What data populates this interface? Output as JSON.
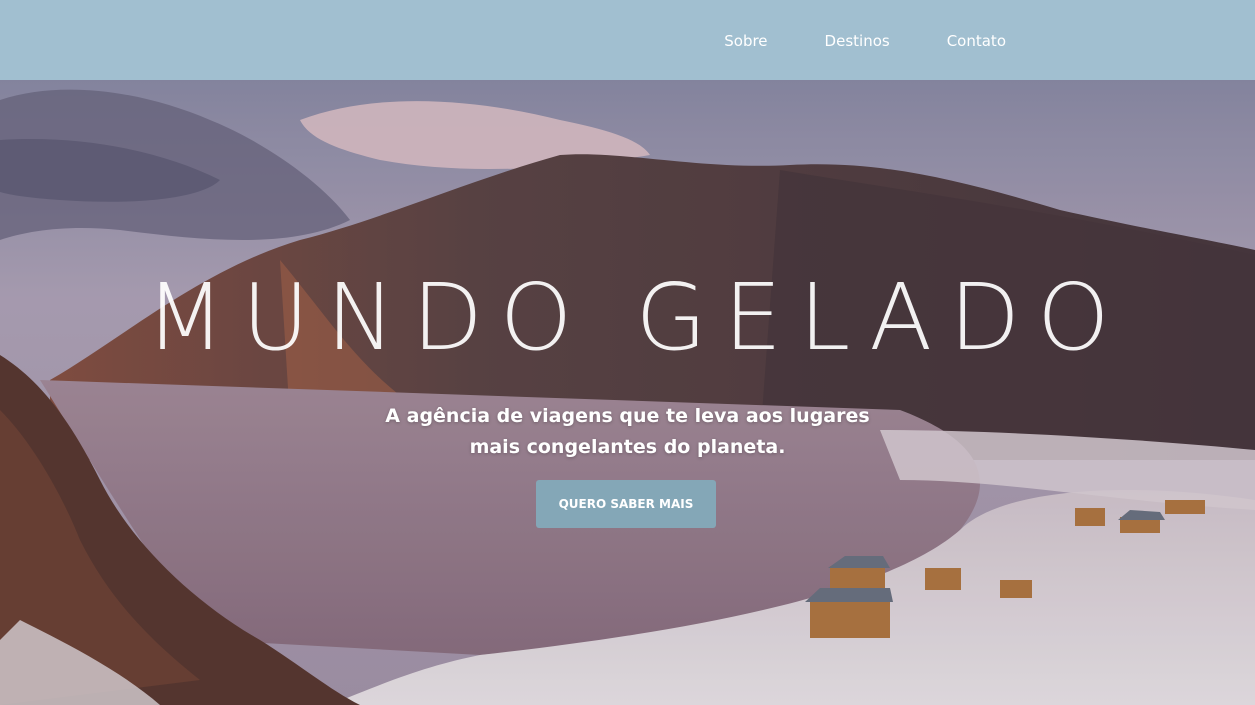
{
  "nav": {
    "items": [
      {
        "label": "Sobre"
      },
      {
        "label": "Destinos"
      },
      {
        "label": "Contato"
      }
    ]
  },
  "hero": {
    "title": "MUNDO GELADO",
    "subtitle": "A agência de viagens que te leva aos lugares mais congelantes do planeta.",
    "cta_label": "QUERO SABER MAIS"
  },
  "colors": {
    "navbar_bg": "#a1bfd0",
    "button_bg": "#84a7b7",
    "text": "#ffffff"
  }
}
